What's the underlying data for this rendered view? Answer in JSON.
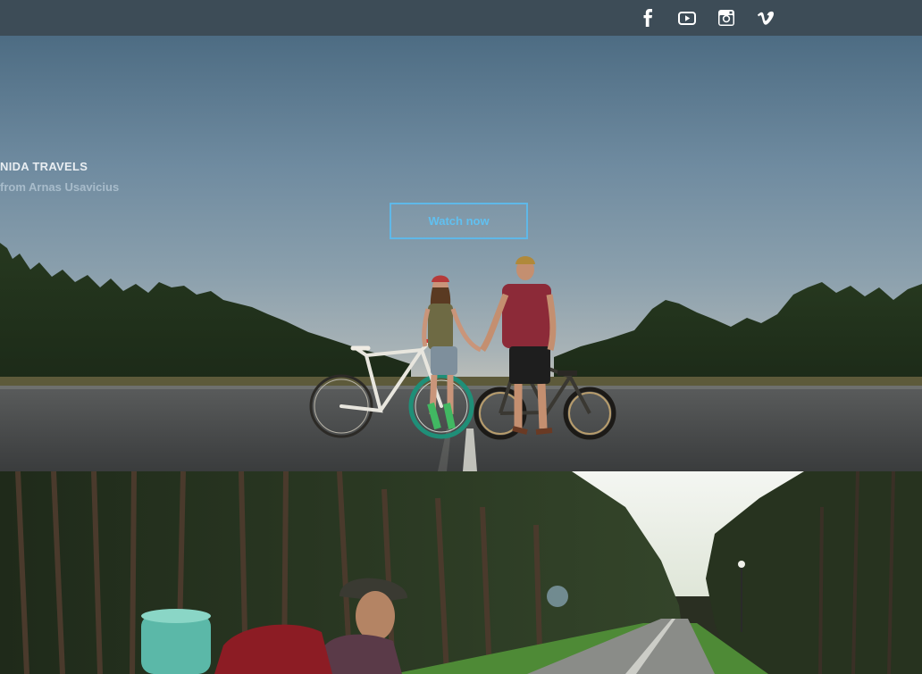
{
  "topbar": {
    "social": [
      {
        "name": "facebook-icon"
      },
      {
        "name": "youtube-icon"
      },
      {
        "name": "instagram-icon"
      },
      {
        "name": "vimeo-icon"
      }
    ]
  },
  "hero": {
    "title": "NIDA TRAVELS",
    "subtitle": "from Arnas Usavicius",
    "cta_label": "Watch now"
  },
  "colors": {
    "topbar_bg": "#3d4c57",
    "accent": "#5fb8e8",
    "title": "#e9eef2",
    "subtitle": "#a8bccb"
  }
}
